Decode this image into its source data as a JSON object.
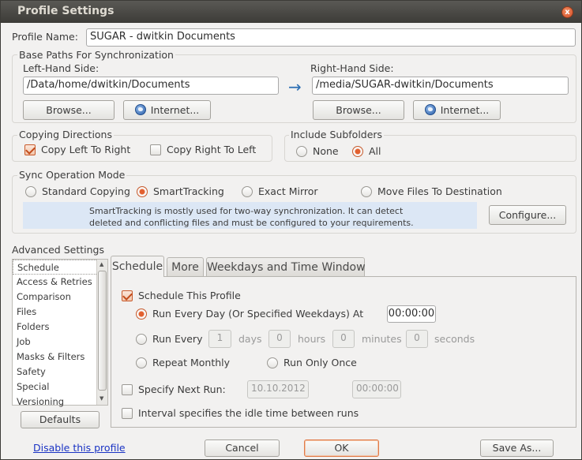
{
  "window": {
    "title": "Profile Settings",
    "close_label": "x"
  },
  "profile_name": {
    "label": "Profile Name:",
    "value": "SUGAR - dwitkin Documents"
  },
  "base_paths": {
    "title": "Base Paths For Synchronization",
    "left": {
      "label": "Left-Hand Side:",
      "value": "/Data/home/dwitkin/Documents",
      "browse": "Browse...",
      "internet": "Internet..."
    },
    "arrow": "→",
    "right": {
      "label": "Right-Hand Side:",
      "value": "/media/SUGAR-dwitkin/Documents",
      "browse": "Browse...",
      "internet": "Internet..."
    }
  },
  "copying": {
    "title": "Copying Directions",
    "left_to_right": "Copy Left To Right",
    "left_to_right_checked": true,
    "right_to_left": "Copy Right To Left",
    "right_to_left_checked": false
  },
  "subfolders": {
    "title": "Include Subfolders",
    "none": "None",
    "all": "All",
    "selected": "all"
  },
  "sync_mode": {
    "title": "Sync Operation Mode",
    "options": [
      "Standard Copying",
      "SmartTracking",
      "Exact Mirror",
      "Move Files To Destination"
    ],
    "selected": "SmartTracking",
    "info_line1": "SmartTracking is mostly used for two-way synchronization. It can detect",
    "info_line2": "deleted and conflicting files and must be configured to your requirements.",
    "configure": "Configure..."
  },
  "advanced": {
    "title": "Advanced Settings",
    "items": [
      "Schedule",
      "Access & Retries",
      "Comparison",
      "Files",
      "Folders",
      "Job",
      "Masks & Filters",
      "Safety",
      "Special",
      "Versioning"
    ],
    "selected": "Schedule",
    "defaults": "Defaults"
  },
  "tabs": [
    "Schedule",
    "More",
    "Weekdays and Time Window"
  ],
  "schedule": {
    "schedule_this": "Schedule This Profile",
    "run_every_day": "Run Every Day (Or Specified Weekdays) At",
    "time_value": "00:00:00",
    "run_every": "Run Every",
    "days_value": "1",
    "days_label": "days",
    "hours_value": "0",
    "hours_label": "hours",
    "minutes_value": "0",
    "minutes_label": "minutes",
    "seconds_value": "0",
    "seconds_label": "seconds",
    "repeat_monthly": "Repeat Monthly",
    "run_only_once": "Run Only Once",
    "specify_next_run": "Specify Next Run:",
    "next_date": "10.10.2012",
    "next_time": "00:00:00",
    "interval_idle": "Interval specifies the idle time between runs"
  },
  "footer": {
    "disable_link": "Disable this profile",
    "cancel": "Cancel",
    "ok": "OK",
    "save_as": "Save As..."
  },
  "colors": {
    "accent": "#e2602f",
    "link": "#1a33c4",
    "info_bg": "#dce7f5",
    "titlebar": "#3c3b37"
  }
}
